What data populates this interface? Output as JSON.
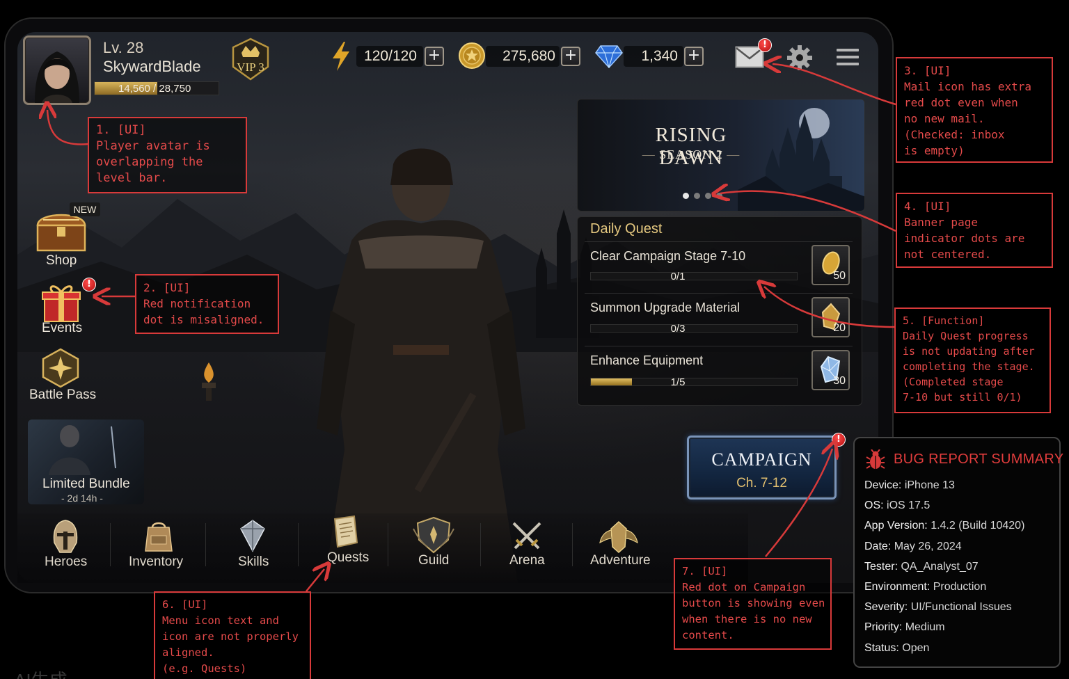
{
  "player": {
    "level": "Lv. 28",
    "name": "SkywardBlade",
    "xp_current": "14,560",
    "xp_total": "28,750",
    "xp_fraction": 0.506,
    "vip": "VIP 3"
  },
  "resources": {
    "energy": "120/120",
    "gold": "275,680",
    "gems": "1,340",
    "plus": "+"
  },
  "notifications": {
    "dot_symbol": "!"
  },
  "side_menu": {
    "shop": "Shop",
    "new_badge": "NEW",
    "events": "Events",
    "battle_pass": "Battle Pass",
    "bundle_title": "Limited Bundle",
    "bundle_timer": "- 2d 14h -"
  },
  "banner": {
    "title": "RISING DAWN",
    "subtitle": "SEASON 2",
    "pages": 4,
    "active_page": 0
  },
  "daily_quest": {
    "title": "Daily Quest",
    "quests": [
      {
        "name": "Clear Campaign Stage 7-10",
        "progress": "0/1",
        "fraction": 0,
        "reward_qty": "50",
        "reward_icon": "gold-coin-icon"
      },
      {
        "name": "Summon Upgrade Material",
        "progress": "0/3",
        "fraction": 0,
        "reward_qty": "20",
        "reward_icon": "gold-coin-icon"
      },
      {
        "name": "Enhance Equipment",
        "progress": "1/5",
        "fraction": 0.2,
        "reward_qty": "30",
        "reward_icon": "blue-gem-icon"
      }
    ]
  },
  "campaign": {
    "label": "CAMPAIGN",
    "chapter": "Ch. 7-12"
  },
  "bottom_nav": {
    "heroes": "Heroes",
    "inventory": "Inventory",
    "skills": "Skills",
    "quests": "Quests",
    "guild": "Guild",
    "arena": "Arena",
    "adventure": "Adventure"
  },
  "annotations": {
    "note1": "1. [UI]\nPlayer avatar is\noverlapping the\nlevel bar.",
    "note2": "2. [UI]\nRed notification\ndot is misaligned.",
    "note3": "3. [UI]\nMail icon has extra\nred dot even when\nno new mail.\n(Checked: inbox\nis empty)",
    "note4": "4. [UI]\nBanner page\nindicator dots are\nnot centered.",
    "note5": "5. [Function]\nDaily Quest progress\nis not updating after\ncompleting the stage.\n(Completed stage\n7-10 but still 0/1)",
    "note6": "6. [UI]\nMenu icon text and\nicon are not properly\naligned.\n(e.g. Quests)",
    "note7": "7. [UI]\nRed dot on Campaign\nbutton is showing even\nwhen there is no new\ncontent."
  },
  "bug_summary": {
    "title": "BUG REPORT SUMMARY",
    "rows": [
      {
        "key": "Device:",
        "value": "iPhone 13"
      },
      {
        "key": "OS:",
        "value": "iOS 17.5"
      },
      {
        "key": "App Version:",
        "value": "1.4.2 (Build 10420)"
      },
      {
        "key": "Date:",
        "value": "May 26, 2024"
      },
      {
        "key": "Tester:",
        "value": "QA_Analyst_07"
      },
      {
        "key": "Environment:",
        "value": "Production"
      },
      {
        "key": "Severity:",
        "value": "UI/Functional Issues"
      },
      {
        "key": "Priority:",
        "value": "Medium"
      },
      {
        "key": "Status:",
        "value": "Open"
      }
    ]
  },
  "colors": {
    "annotation": "#d83a3a",
    "gold": "#e6c980",
    "bug_title": "#e23d3d"
  },
  "watermark": "AI生成"
}
